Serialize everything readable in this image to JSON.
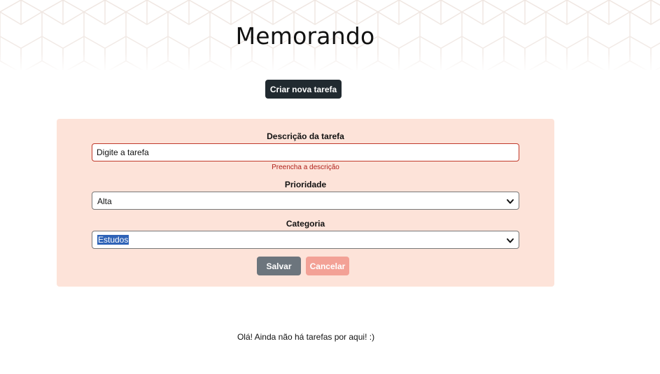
{
  "header": {
    "title": "Memorando",
    "pattern_color": "#efe8e3"
  },
  "toolbar": {
    "new_task_label": "Criar nova tarefa"
  },
  "form": {
    "description": {
      "label": "Descrição da tarefa",
      "placeholder": "Digite a tarefa",
      "value": "",
      "error": "Preencha a descrição"
    },
    "priority": {
      "label": "Prioridade",
      "selected": "Alta"
    },
    "category": {
      "label": "Categoria",
      "selected": "Estudos"
    },
    "save_label": "Salvar",
    "cancel_label": "Cancelar"
  },
  "tasks": {
    "empty_message": "Olá! Ainda não há tarefas por aqui! :)"
  },
  "colors": {
    "card_bg": "#fde3d9",
    "primary_dark": "#212a30",
    "error": "#b0201a",
    "save": "#6c757d",
    "cancel": "#f3a196"
  }
}
